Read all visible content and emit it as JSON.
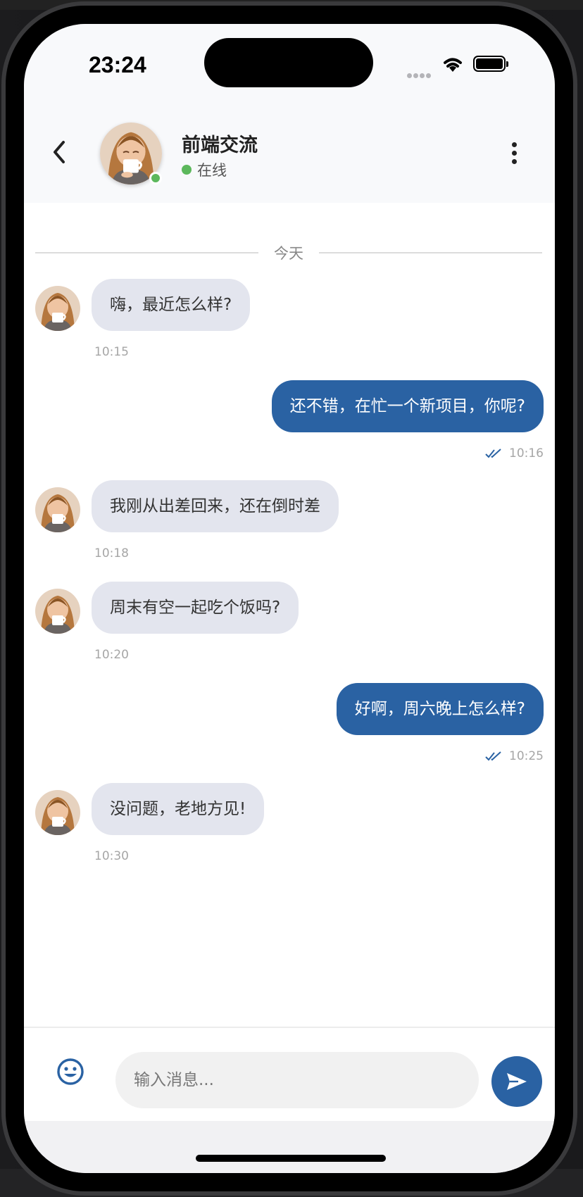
{
  "status_bar": {
    "time": "23:24"
  },
  "header": {
    "title": "前端交流",
    "status": "在线",
    "avatar_icon": "woman-drinking-coffee-avatar",
    "back_icon": "chevron-left-icon",
    "more_icon": "more-vertical-icon"
  },
  "chat": {
    "date_divider": "今天",
    "messages": [
      {
        "direction": "in",
        "text": "嗨，最近怎么样?",
        "time": "10:15"
      },
      {
        "direction": "out",
        "text": "还不错，在忙一个新项目，你呢?",
        "time": "10:16",
        "read": true
      },
      {
        "direction": "in",
        "text": "我刚从出差回来，还在倒时差",
        "time": "10:18"
      },
      {
        "direction": "in",
        "text": "周末有空一起吃个饭吗?",
        "time": "10:20"
      },
      {
        "direction": "out",
        "text": "好啊，周六晚上怎么样?",
        "time": "10:25",
        "read": true
      },
      {
        "direction": "in",
        "text": "没问题，老地方见!",
        "time": "10:30"
      }
    ]
  },
  "input_bar": {
    "placeholder": "输入消息...",
    "value": "",
    "emoji_icon": "emoji-smile-icon",
    "send_icon": "send-icon"
  },
  "colors": {
    "accent": "#2a62a3",
    "incoming_bubble": "#e3e5ee",
    "online": "#5cb85c"
  }
}
